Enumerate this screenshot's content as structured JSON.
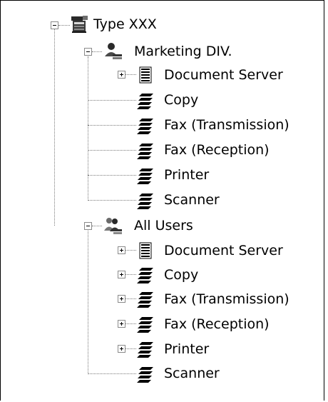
{
  "tree": {
    "root": {
      "label": "Type XXX",
      "icon": "machine-icon",
      "children": [
        {
          "label": "Marketing DIV.",
          "icon": "user-group-icon",
          "items": [
            {
              "label": "Document Server",
              "icon": "document-stack-icon",
              "expandable": true
            },
            {
              "label": "Copy",
              "icon": "paper-stack-icon",
              "expandable": false
            },
            {
              "label": "Fax (Transmission)",
              "icon": "paper-stack-icon",
              "expandable": false
            },
            {
              "label": "Fax (Reception)",
              "icon": "paper-stack-icon",
              "expandable": false
            },
            {
              "label": "Printer",
              "icon": "paper-stack-icon",
              "expandable": false
            },
            {
              "label": "Scanner",
              "icon": "paper-stack-icon",
              "expandable": false
            }
          ]
        },
        {
          "label": "All Users",
          "icon": "all-users-icon",
          "items": [
            {
              "label": "Document Server",
              "icon": "document-stack-icon",
              "expandable": true
            },
            {
              "label": "Copy",
              "icon": "paper-stack-icon",
              "expandable": true
            },
            {
              "label": "Fax (Transmission)",
              "icon": "paper-stack-icon",
              "expandable": true
            },
            {
              "label": "Fax (Reception)",
              "icon": "paper-stack-icon",
              "expandable": true
            },
            {
              "label": "Printer",
              "icon": "paper-stack-icon",
              "expandable": true
            },
            {
              "label": "Scanner",
              "icon": "paper-stack-icon",
              "expandable": false
            }
          ]
        }
      ]
    }
  }
}
